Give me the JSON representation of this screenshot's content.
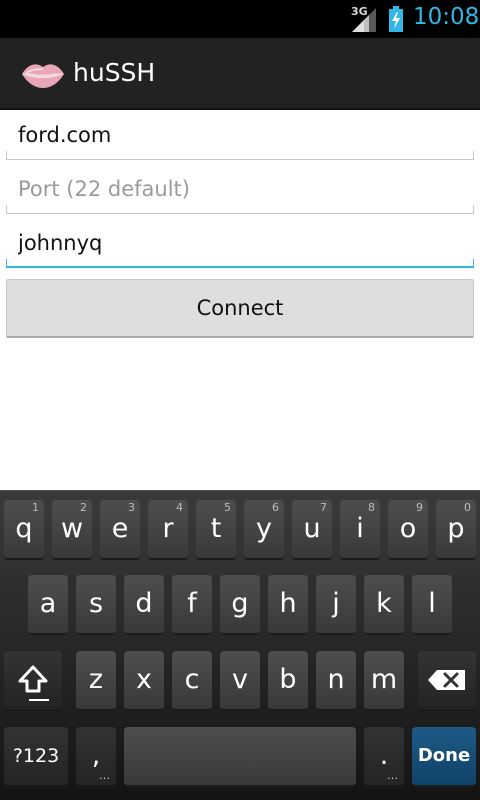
{
  "status_bar": {
    "network": "3G",
    "time": "10:08",
    "colors": {
      "time": "#33b5e5",
      "battery": "#33b5e5"
    }
  },
  "action_bar": {
    "title": "huSSH",
    "icon": "lips-icon"
  },
  "form": {
    "host": {
      "value": "ford.com",
      "placeholder": ""
    },
    "port": {
      "value": "",
      "placeholder": "Port (22 default)"
    },
    "user": {
      "value": "johnnyq",
      "placeholder": ""
    },
    "connect_label": "Connect",
    "focus_color": "#33b5e5"
  },
  "keyboard": {
    "row1": [
      {
        "label": "q",
        "hint": "1"
      },
      {
        "label": "w",
        "hint": "2"
      },
      {
        "label": "e",
        "hint": "3"
      },
      {
        "label": "r",
        "hint": "4"
      },
      {
        "label": "t",
        "hint": "5"
      },
      {
        "label": "y",
        "hint": "6"
      },
      {
        "label": "u",
        "hint": "7"
      },
      {
        "label": "i",
        "hint": "8"
      },
      {
        "label": "o",
        "hint": "9"
      },
      {
        "label": "p",
        "hint": "0"
      }
    ],
    "row2": [
      "a",
      "s",
      "d",
      "f",
      "g",
      "h",
      "j",
      "k",
      "l"
    ],
    "row3": [
      "z",
      "x",
      "c",
      "v",
      "b",
      "n",
      "m"
    ],
    "shift_icon": "shift-icon",
    "delete_icon": "backspace-icon",
    "symbols_label": "?123",
    "comma_label": ",",
    "period_label": ".",
    "done_label": "Done",
    "done_color": "#0f4268"
  }
}
